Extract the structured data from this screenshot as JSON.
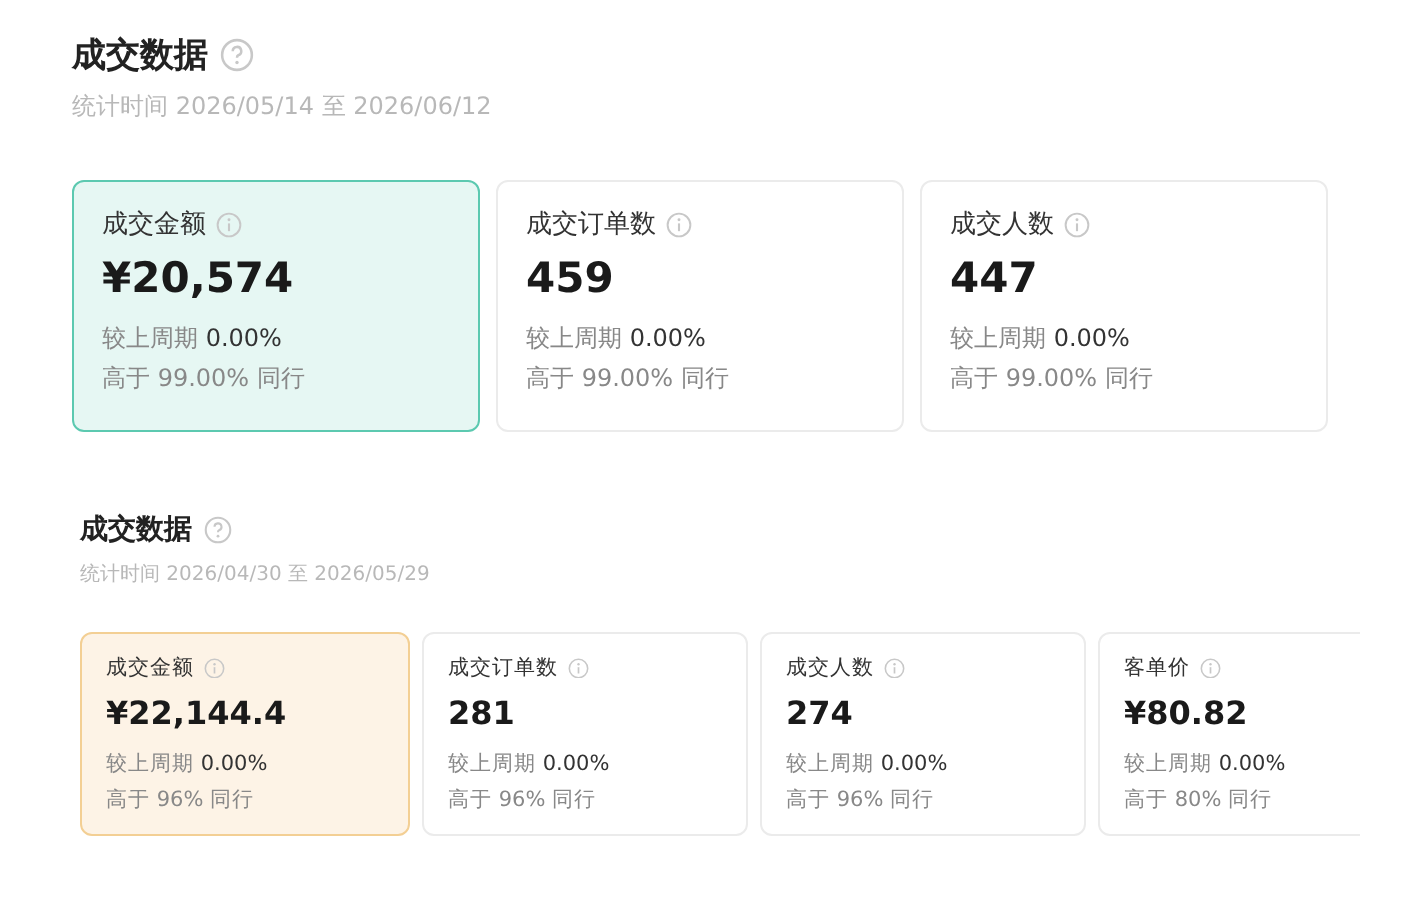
{
  "sections": [
    {
      "kind": "large",
      "title": "成交数据",
      "period": "统计时间 2026/05/14 至 2026/06/12",
      "cards": [
        {
          "label": "成交金额",
          "value": "¥20,574",
          "change_label": "较上周期",
          "change": "0.00%",
          "peer": "高于 99.00% 同行",
          "selected": true
        },
        {
          "label": "成交订单数",
          "value": "459",
          "change_label": "较上周期",
          "change": "0.00%",
          "peer": "高于 99.00% 同行",
          "selected": false
        },
        {
          "label": "成交人数",
          "value": "447",
          "change_label": "较上周期",
          "change": "0.00%",
          "peer": "高于 99.00% 同行",
          "selected": false
        }
      ]
    },
    {
      "kind": "compact",
      "title": "成交数据",
      "period": "统计时间 2026/04/30 至 2026/05/29",
      "cards": [
        {
          "label": "成交金额",
          "value": "¥22,144.4",
          "change_label": "较上周期",
          "change": "0.00%",
          "peer": "高于 96% 同行",
          "selected": true
        },
        {
          "label": "成交订单数",
          "value": "281",
          "change_label": "较上周期",
          "change": "0.00%",
          "peer": "高于 96% 同行",
          "selected": false
        },
        {
          "label": "成交人数",
          "value": "274",
          "change_label": "较上周期",
          "change": "0.00%",
          "peer": "高于 96% 同行",
          "selected": false
        },
        {
          "label": "客单价",
          "value": "¥80.82",
          "change_label": "较上周期",
          "change": "0.00%",
          "peer": "高于 80% 同行",
          "selected": false
        }
      ]
    }
  ]
}
